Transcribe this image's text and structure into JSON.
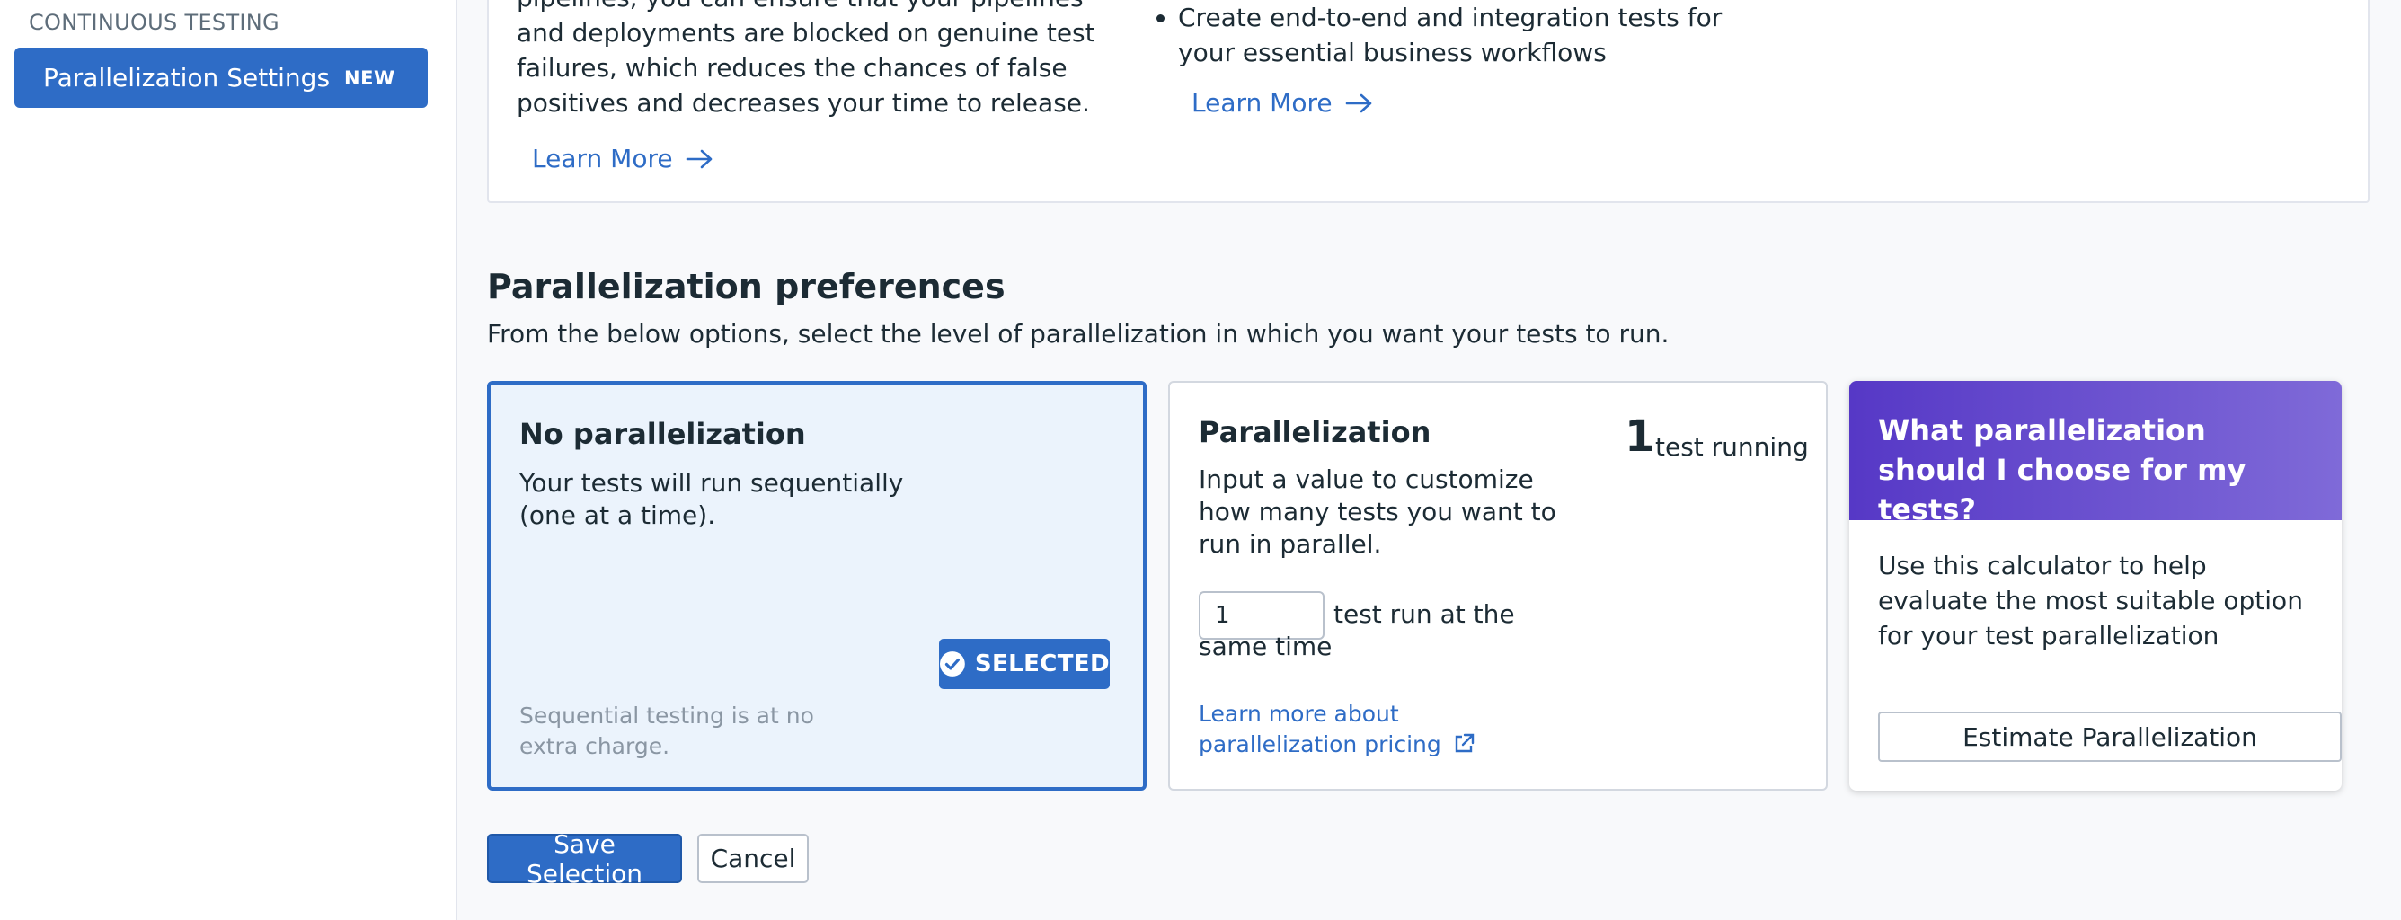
{
  "sidebar": {
    "section_heading": "CONTINUOUS TESTING",
    "active_item": {
      "label": "Parallelization Settings",
      "badge": "NEW"
    }
  },
  "info": {
    "left_text": "pipelines, you can ensure that your pipelines and deployments are blocked on genuine test failures, which reduces the chances of false positives and decreases your time to release.",
    "left_link": "Learn More",
    "right_bullet": "Create end-to-end and integration tests for your essential business workflows",
    "right_link": "Learn More"
  },
  "preferences": {
    "title": "Parallelization preferences",
    "description": "From the below options, select the level of parallelization in which you want your tests to run."
  },
  "no_parallel_card": {
    "title": "No parallelization",
    "text_line1": "Your tests will run sequentially",
    "text_line2": "(one at a time).",
    "selected_label": "SELECTED",
    "footnote": "Sequential testing is at no extra charge."
  },
  "parallel_card": {
    "title": "Parallelization",
    "count": "1",
    "count_label": "test running",
    "description": "Input a value to customize how many tests you want to run in parallel.",
    "input_value": "1",
    "input_suffix": "test run at the same time",
    "pricing_link": "Learn more about parallelization pricing"
  },
  "calculator_card": {
    "title": "What parallelization should I choose for my tests?",
    "text": "Use this calculator to help evaluate the most suitable option for your test parallelization",
    "button": "Estimate Parallelization"
  },
  "actions": {
    "save": "Save Selection",
    "cancel": "Cancel"
  },
  "colors": {
    "primary": "#2e6cc6",
    "calc_gradient_start": "#5638c6",
    "calc_gradient_end": "#7f6ad8"
  }
}
